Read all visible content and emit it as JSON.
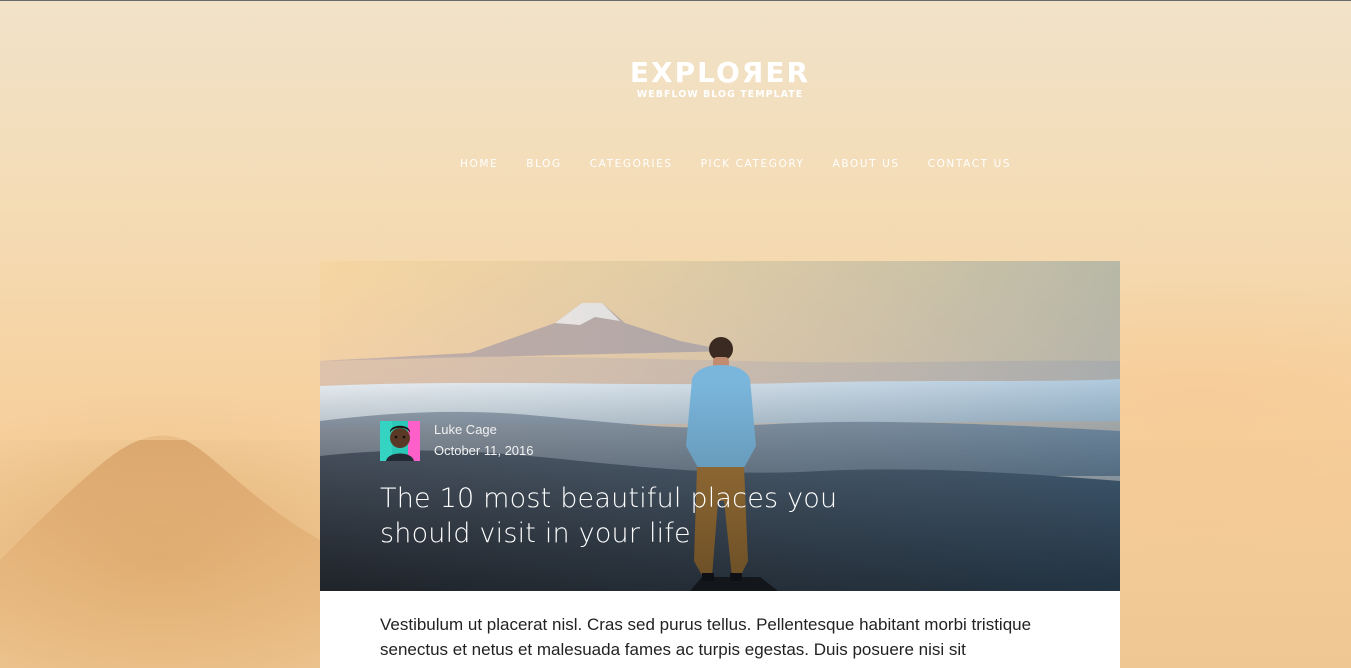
{
  "site": {
    "logo_title": "EXPLOЯER",
    "logo_subtitle": "WEBFLOW BLOG TEMPLATE"
  },
  "nav": {
    "items": [
      {
        "label": "HOME"
      },
      {
        "label": "BLOG"
      },
      {
        "label": "CATEGORIES"
      },
      {
        "label": "PICK CATEGORY"
      },
      {
        "label": "ABOUT US"
      },
      {
        "label": "CONTACT US"
      }
    ]
  },
  "post": {
    "author": "Luke Cage",
    "date": "October 11, 2016",
    "title": "The 10 most beautiful places you should visit in your life",
    "excerpt": "Vestibulum ut placerat nisl. Cras sed purus tellus. Pellentesque habitant morbi tristique senectus et netus et malesuada fames ac turpis egestas. Duis posuere nisi sit"
  },
  "icons": {
    "logo": "explorer-logo",
    "avatar": "author-avatar"
  },
  "colors": {
    "nav_text": "#ffffff",
    "excerpt_text": "#222222",
    "background_warm": "#f4d7ab"
  }
}
